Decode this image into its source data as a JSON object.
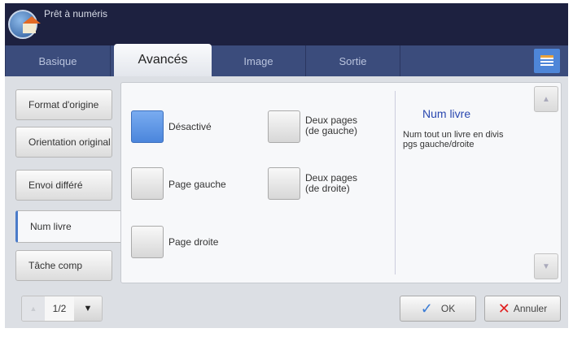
{
  "header": {
    "title": "Prêt à numéris"
  },
  "tabs": [
    {
      "label": "Basique"
    },
    {
      "label": "Avancés"
    },
    {
      "label": "Image"
    },
    {
      "label": "Sortie"
    }
  ],
  "left_menu": [
    {
      "label": "Format d'origine"
    },
    {
      "label": "Orientation original"
    },
    {
      "label": "Envoi différé"
    },
    {
      "label": "Num livre"
    },
    {
      "label": "Tâche comp"
    }
  ],
  "options": [
    {
      "label": "Désactivé",
      "selected": true
    },
    {
      "label": "Page gauche"
    },
    {
      "label": "Page droite"
    },
    {
      "label": "Deux pages (de gauche)"
    },
    {
      "label": "Deux pages (de droite)"
    }
  ],
  "info": {
    "title": "Num livre",
    "description": "Num tout un livre en divis pgs gauche/droite"
  },
  "pager": {
    "page": "1/2"
  },
  "buttons": {
    "ok": "OK",
    "cancel": "Annuler"
  },
  "colors": {
    "accent": "#4b86dc",
    "header": "#1d2140",
    "tabbar": "#3b4c7c"
  }
}
